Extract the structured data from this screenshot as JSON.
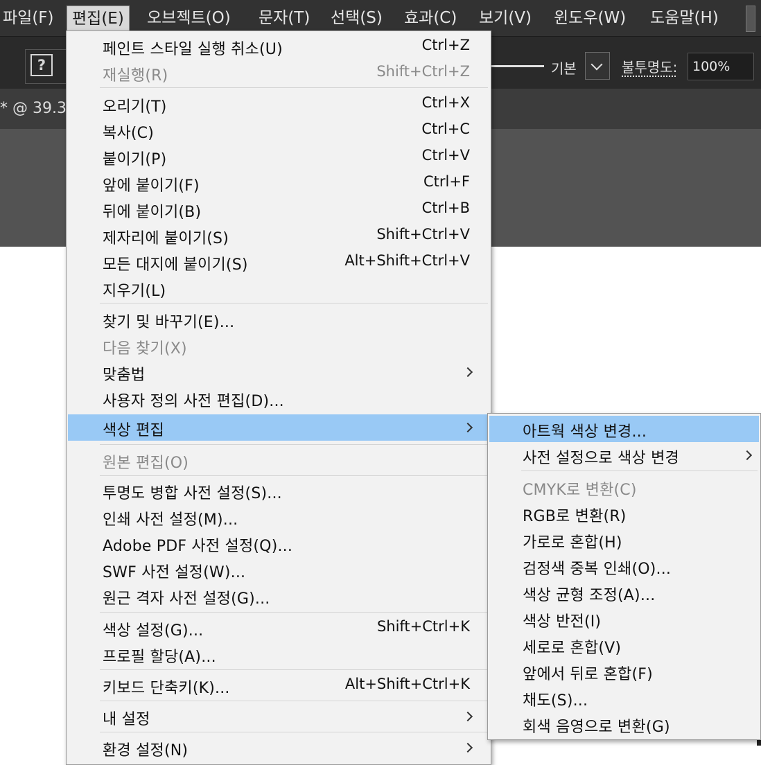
{
  "menubar": {
    "items": [
      "파일(F)",
      "편집(E)",
      "오브젝트(O)",
      "문자(T)",
      "선택(S)",
      "효과(C)",
      "보기(V)",
      "윈도우(W)",
      "도움말(H)"
    ],
    "active_index": 1
  },
  "controlbar": {
    "unknown_icon": "?",
    "stroke_style_label": "기본",
    "opacity_label": "불투명도:",
    "opacity_value": "100%"
  },
  "document_tab": {
    "text": "* @ 39.3"
  },
  "edit_menu": {
    "items": [
      {
        "label": "페인트 스타일 실행 취소(U)",
        "shortcut": "Ctrl+Z",
        "enabled": true
      },
      {
        "label": "재실행(R)",
        "shortcut": "Shift+Ctrl+Z",
        "enabled": false
      },
      {
        "label": "오리기(T)",
        "shortcut": "Ctrl+X",
        "enabled": true
      },
      {
        "label": "복사(C)",
        "shortcut": "Ctrl+C",
        "enabled": true
      },
      {
        "label": "붙이기(P)",
        "shortcut": "Ctrl+V",
        "enabled": true
      },
      {
        "label": "앞에 붙이기(F)",
        "shortcut": "Ctrl+F",
        "enabled": true
      },
      {
        "label": "뒤에 붙이기(B)",
        "shortcut": "Ctrl+B",
        "enabled": true
      },
      {
        "label": "제자리에 붙이기(S)",
        "shortcut": "Shift+Ctrl+V",
        "enabled": true
      },
      {
        "label": "모든 대지에 붙이기(S)",
        "shortcut": "Alt+Shift+Ctrl+V",
        "enabled": true
      },
      {
        "label": "지우기(L)",
        "shortcut": "",
        "enabled": true
      },
      {
        "label": "찾기 및 바꾸기(E)...",
        "shortcut": "",
        "enabled": true
      },
      {
        "label": "다음 찾기(X)",
        "shortcut": "",
        "enabled": false
      },
      {
        "label": "맞춤법",
        "shortcut": "",
        "enabled": true,
        "submenu": true
      },
      {
        "label": "사용자 정의 사전 편집(D)...",
        "shortcut": "",
        "enabled": true
      },
      {
        "label": "색상 편집",
        "shortcut": "",
        "enabled": true,
        "submenu": true,
        "highlighted": true
      },
      {
        "label": "원본 편집(O)",
        "shortcut": "",
        "enabled": false
      },
      {
        "label": "투명도 병합 사전 설정(S)...",
        "shortcut": "",
        "enabled": true
      },
      {
        "label": "인쇄 사전 설정(M)...",
        "shortcut": "",
        "enabled": true
      },
      {
        "label": "Adobe PDF 사전 설정(Q)...",
        "shortcut": "",
        "enabled": true
      },
      {
        "label": "SWF 사전 설정(W)...",
        "shortcut": "",
        "enabled": true
      },
      {
        "label": "원근 격자 사전 설정(G)...",
        "shortcut": "",
        "enabled": true
      },
      {
        "label": "색상 설정(G)...",
        "shortcut": "Shift+Ctrl+K",
        "enabled": true
      },
      {
        "label": "프로필 할당(A)...",
        "shortcut": "",
        "enabled": true
      },
      {
        "label": "키보드 단축키(K)...",
        "shortcut": "Alt+Shift+Ctrl+K",
        "enabled": true
      },
      {
        "label": "내 설정",
        "shortcut": "",
        "enabled": true,
        "submenu": true
      },
      {
        "label": "환경 설정(N)",
        "shortcut": "",
        "enabled": true,
        "submenu": true
      }
    ]
  },
  "color_submenu": {
    "items": [
      {
        "label": "아트웍 색상 변경...",
        "enabled": true,
        "highlighted": true
      },
      {
        "label": "사전 설정으로 색상 변경",
        "enabled": true,
        "submenu": true
      },
      {
        "label": "CMYK로 변환(C)",
        "enabled": false
      },
      {
        "label": "RGB로 변환(R)",
        "enabled": true
      },
      {
        "label": "가로로 혼합(H)",
        "enabled": true
      },
      {
        "label": "검정색 중복 인쇄(O)...",
        "enabled": true
      },
      {
        "label": "색상 균형 조정(A)...",
        "enabled": true
      },
      {
        "label": "색상 반전(I)",
        "enabled": true
      },
      {
        "label": "세로로 혼합(V)",
        "enabled": true
      },
      {
        "label": "앞에서 뒤로 혼합(F)",
        "enabled": true
      },
      {
        "label": "채도(S)...",
        "enabled": true
      },
      {
        "label": "회색 음영으로 변환(G)",
        "enabled": true
      }
    ]
  }
}
